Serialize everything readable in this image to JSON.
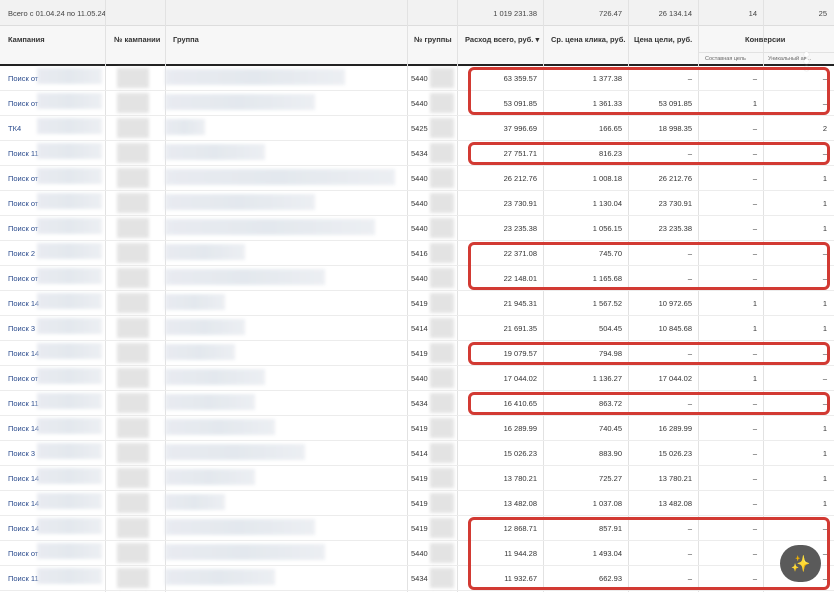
{
  "summary": {
    "period": "Всего с 01.04.24 по 11.05.24",
    "spend": "1 019 231.38",
    "cpc": "726.47",
    "goal_cost": "26 134.14",
    "composite": "14",
    "unique": "25"
  },
  "headers": {
    "campaign": "Кампания",
    "campaign_no": "№ кампании",
    "group": "Группа",
    "group_no": "№ группы",
    "spend": "Расход всего, руб. ▾",
    "cpc": "Ср. цена клика, руб.",
    "goal_cost": "Цена цели, руб.",
    "conversions": "Конверсии",
    "composite": "Составная цель",
    "unique": "Уникальный ав..."
  },
  "rows": [
    {
      "campaign": "Поиск от",
      "group_no": "5440",
      "spend": "63 359.57",
      "cpc": "1 377.38",
      "goal_cost": "–",
      "composite": "–",
      "unique": "–"
    },
    {
      "campaign": "Поиск от",
      "group_no": "5440",
      "spend": "53 091.85",
      "cpc": "1 361.33",
      "goal_cost": "53 091.85",
      "composite": "1",
      "unique": "–"
    },
    {
      "campaign": "ТК4",
      "group_no": "5425",
      "spend": "37 996.69",
      "cpc": "166.65",
      "goal_cost": "18 998.35",
      "composite": "–",
      "unique": "2"
    },
    {
      "campaign": "Поиск 11",
      "group_no": "5434",
      "spend": "27 751.71",
      "cpc": "816.23",
      "goal_cost": "–",
      "composite": "–",
      "unique": "–"
    },
    {
      "campaign": "Поиск от",
      "group_no": "5440",
      "spend": "26 212.76",
      "cpc": "1 008.18",
      "goal_cost": "26 212.76",
      "composite": "–",
      "unique": "1"
    },
    {
      "campaign": "Поиск от",
      "group_no": "5440",
      "spend": "23 730.91",
      "cpc": "1 130.04",
      "goal_cost": "23 730.91",
      "composite": "–",
      "unique": "1"
    },
    {
      "campaign": "Поиск от",
      "group_no": "5440",
      "spend": "23 235.38",
      "cpc": "1 056.15",
      "goal_cost": "23 235.38",
      "composite": "–",
      "unique": "1"
    },
    {
      "campaign": "Поиск 2",
      "group_no": "5416",
      "spend": "22 371.08",
      "cpc": "745.70",
      "goal_cost": "–",
      "composite": "–",
      "unique": "–"
    },
    {
      "campaign": "Поиск от",
      "group_no": "5440",
      "spend": "22 148.01",
      "cpc": "1 165.68",
      "goal_cost": "–",
      "composite": "–",
      "unique": "–"
    },
    {
      "campaign": "Поиск 14",
      "group_no": "5419",
      "spend": "21 945.31",
      "cpc": "1 567.52",
      "goal_cost": "10 972.65",
      "composite": "1",
      "unique": "1"
    },
    {
      "campaign": "Поиск 3",
      "group_no": "5414",
      "spend": "21 691.35",
      "cpc": "504.45",
      "goal_cost": "10 845.68",
      "composite": "1",
      "unique": "1"
    },
    {
      "campaign": "Поиск 14",
      "group_no": "5419",
      "spend": "19 079.57",
      "cpc": "794.98",
      "goal_cost": "–",
      "composite": "–",
      "unique": "–"
    },
    {
      "campaign": "Поиск от",
      "group_no": "5440",
      "spend": "17 044.02",
      "cpc": "1 136.27",
      "goal_cost": "17 044.02",
      "composite": "1",
      "unique": "–"
    },
    {
      "campaign": "Поиск 11",
      "group_no": "5434",
      "spend": "16 410.65",
      "cpc": "863.72",
      "goal_cost": "–",
      "composite": "–",
      "unique": "–"
    },
    {
      "campaign": "Поиск 14",
      "group_no": "5419",
      "spend": "16 289.99",
      "cpc": "740.45",
      "goal_cost": "16 289.99",
      "composite": "–",
      "unique": "1"
    },
    {
      "campaign": "Поиск 3",
      "group_no": "5414",
      "spend": "15 026.23",
      "cpc": "883.90",
      "goal_cost": "15 026.23",
      "composite": "–",
      "unique": "1"
    },
    {
      "campaign": "Поиск 14",
      "group_no": "5419",
      "spend": "13 780.21",
      "cpc": "725.27",
      "goal_cost": "13 780.21",
      "composite": "–",
      "unique": "1"
    },
    {
      "campaign": "Поиск 14",
      "group_no": "5419",
      "spend": "13 482.08",
      "cpc": "1 037.08",
      "goal_cost": "13 482.08",
      "composite": "–",
      "unique": "1"
    },
    {
      "campaign": "Поиск 14",
      "group_no": "5419",
      "spend": "12 868.71",
      "cpc": "857.91",
      "goal_cost": "–",
      "composite": "–",
      "unique": "–"
    },
    {
      "campaign": "Поиск от",
      "group_no": "5440",
      "spend": "11 944.28",
      "cpc": "1 493.04",
      "goal_cost": "–",
      "composite": "–",
      "unique": "–"
    },
    {
      "campaign": "Поиск 11",
      "group_no": "5434",
      "spend": "11 932.67",
      "cpc": "662.93",
      "goal_cost": "–",
      "composite": "–",
      "unique": "–"
    }
  ],
  "highlight_groups": [
    [
      0,
      1
    ],
    [
      3,
      3
    ],
    [
      7,
      8
    ],
    [
      11,
      11
    ],
    [
      13,
      13
    ],
    [
      18,
      20
    ]
  ],
  "colors": {
    "highlight": "#d23a33",
    "link": "#2a4b8d"
  }
}
